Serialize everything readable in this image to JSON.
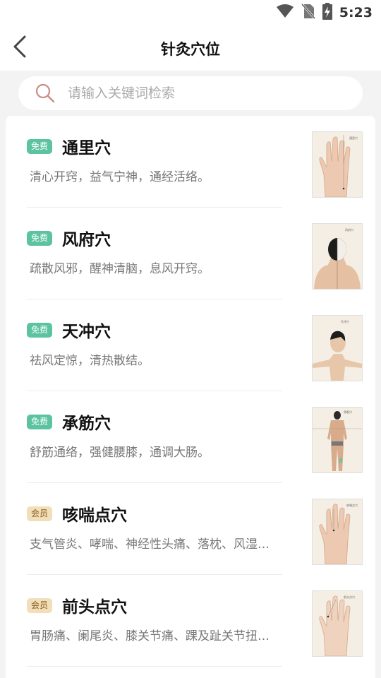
{
  "status_bar": {
    "time": "5:23"
  },
  "header": {
    "title": "针灸穴位"
  },
  "search": {
    "placeholder": "请输入关键词检索",
    "value": ""
  },
  "items": [
    {
      "badge": "免费",
      "badge_type": "free",
      "title": "通里穴",
      "desc": "清心开窍，益气宁神，通经活络。",
      "thumb_icon": "hand-acupoint-image"
    },
    {
      "badge": "免费",
      "badge_type": "free",
      "title": "风府穴",
      "desc": "疏散风邪，醒神清脑，息风开窍。",
      "thumb_icon": "head-back-acupoint-image"
    },
    {
      "badge": "免费",
      "badge_type": "free",
      "title": "天冲穴",
      "desc": "祛风定惊，清热散结。",
      "thumb_icon": "head-side-acupoint-image"
    },
    {
      "badge": "免费",
      "badge_type": "free",
      "title": "承筋穴",
      "desc": "舒筋通络，强健腰膝，通调大肠。",
      "thumb_icon": "body-back-acupoint-image"
    },
    {
      "badge": "会员",
      "badge_type": "member",
      "title": "咳喘点穴",
      "desc": "支气管炎、哮喘、神经性头痛、落枕、风湿…",
      "thumb_icon": "hand-acupoint-image"
    },
    {
      "badge": "会员",
      "badge_type": "member",
      "title": "前头点穴",
      "desc": "胃肠痛、阑尾炎、膝关节痛、踝及趾关节扭…",
      "thumb_icon": "hand-acupoint-image"
    }
  ],
  "colors": {
    "free_badge": "#5cc3a0",
    "member_badge": "#f1dfba",
    "background": "#f3f3f3"
  }
}
